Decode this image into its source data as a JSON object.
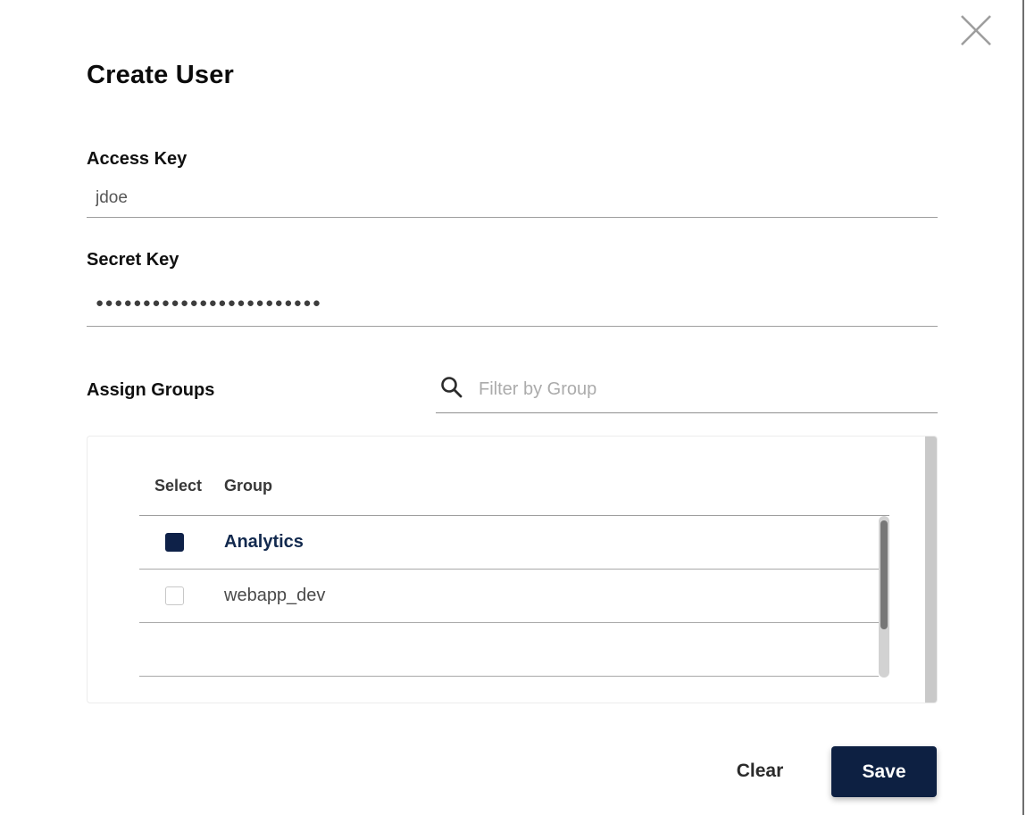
{
  "modal": {
    "title": "Create User"
  },
  "access_key": {
    "label": "Access Key",
    "value": "jdoe"
  },
  "secret_key": {
    "label": "Secret Key",
    "masked_value": "●●●●●●●●●●●●●●●●●●●●●●●●"
  },
  "assign_groups": {
    "label": "Assign Groups",
    "filter": {
      "placeholder": "Filter by Group",
      "value": ""
    },
    "headers": {
      "select": "Select",
      "group": "Group"
    },
    "rows": [
      {
        "group": "Analytics",
        "selected": true
      },
      {
        "group": "webapp_dev",
        "selected": false
      }
    ]
  },
  "actions": {
    "clear_label": "Clear",
    "save_label": "Save"
  },
  "icons": {
    "close": "close-icon",
    "search": "search-icon"
  },
  "colors": {
    "primary_navy": "#0d2042",
    "checkbox_checked": "#0e2148",
    "selected_row_text": "#12294e",
    "divider": "#9e9e9e",
    "scrollbar_thumb": "#777777",
    "outer_scrollbar": "#c9c9c9"
  }
}
